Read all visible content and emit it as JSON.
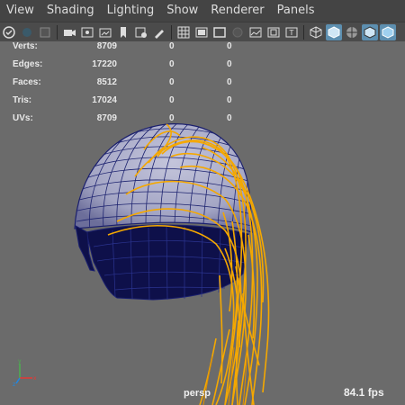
{
  "menu": [
    "View",
    "Shading",
    "Lighting",
    "Show",
    "Renderer",
    "Panels"
  ],
  "toolbar_icons_left": [
    "select-camera-icon",
    "lock-camera-icon",
    "grease-pencil-icon",
    "camera-attributes-icon",
    "bookmark-icon",
    "image-plane-icon",
    "view-transform-icon",
    "2d-pan-zoom-icon",
    "grid-icon",
    "film-gate-icon",
    "resolution-gate-icon",
    "gate-mask-icon",
    "field-chart-icon",
    "safe-action-icon",
    "safe-title-icon"
  ],
  "toolbar_icons_right": [
    "wireframe-icon",
    "smooth-shade-icon",
    "wireframe-on-shaded-icon",
    "xray-icon",
    "xray-joints-icon"
  ],
  "hud": {
    "rows": [
      {
        "label": "Verts:",
        "v1": "8709",
        "v2": "0",
        "v3": "0"
      },
      {
        "label": "Edges:",
        "v1": "17220",
        "v2": "0",
        "v3": "0"
      },
      {
        "label": "Faces:",
        "v1": "8512",
        "v2": "0",
        "v3": "0"
      },
      {
        "label": "Tris:",
        "v1": "17024",
        "v2": "0",
        "v3": "0"
      },
      {
        "label": "UVs:",
        "v1": "8709",
        "v2": "0",
        "v3": "0"
      }
    ]
  },
  "camera": "persp",
  "fps": "84.1 fps",
  "colors": {
    "viewport": "#6b6b6b",
    "helmet_light": "#a9abc9",
    "helmet_dark": "#0e104a",
    "wire": "#1a1f6e",
    "hair": "#f5a800"
  }
}
